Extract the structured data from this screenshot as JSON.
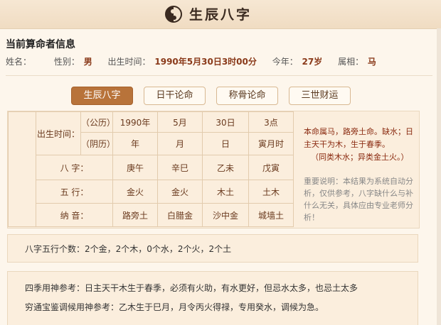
{
  "site": {
    "title": "生辰八字"
  },
  "info": {
    "heading": "当前算命者信息",
    "name_label": "姓名：",
    "gender_label": "性别：",
    "gender": "男",
    "birth_label": "出生时间：",
    "birth": "1990年5月30日3时00分",
    "age_label": "今年：",
    "age": "27岁",
    "zodiac_label": "属相：",
    "zodiac": "马"
  },
  "tabs": [
    "生辰八字",
    "日干论命",
    "称骨论命",
    "三世财运"
  ],
  "bazi": {
    "birth_label": "出生时间：",
    "solar_label": "（公历）",
    "lunar_label": "（阴历）",
    "solar": [
      "1990年",
      "5月",
      "30日",
      "3点"
    ],
    "lunar": [
      "年",
      "月",
      "日",
      "寅月时"
    ],
    "bazi_label": "八 字：",
    "bazi": [
      "庚午",
      "辛巳",
      "乙未",
      "戊寅"
    ],
    "wuxing_label": "五 行：",
    "wuxing": [
      "金火",
      "金火",
      "木土",
      "土木"
    ],
    "nayin_label": "纳 音：",
    "nayin": [
      "路旁土",
      "白腊金",
      "沙中金",
      "城墙土"
    ]
  },
  "side_note": {
    "line1": "本命属马，路旁土命。缺水；日主天干为木，生于春季。",
    "line2": "（同类木水；异类金土火。）",
    "notice": "重要说明：本结果为系统自动分析，仅供参考，八字缺什么与补什么无关，具体应由专业老师分析！"
  },
  "wuxing_count": "八字五行个数：2个金，2个木，0个水，2个火，2个土",
  "reference": {
    "seasons": "四季用神参考：日主天干木生于春季，必须有火助，有水更好，但忌水太多，也忌土太多",
    "qiongtong": "穷通宝鉴调候用神参考：乙木生于巳月，月令丙火得禄，专用癸水，调候为急。"
  }
}
